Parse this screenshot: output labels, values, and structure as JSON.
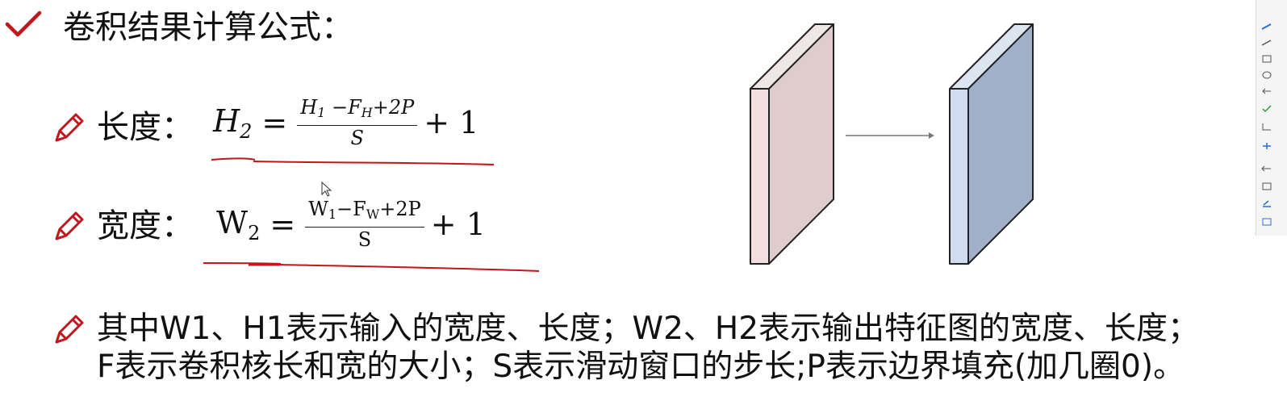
{
  "title": "卷积结果计算公式：",
  "items": [
    {
      "label": "长度：",
      "formula": {
        "lhs": "H",
        "lhs_sub": "2",
        "eq": "=",
        "num_a": "H",
        "num_a_sub": "1",
        "num_b": " −F",
        "num_b_sub": "H",
        "num_c": "+2P",
        "den": "S",
        "tail": "+ 1"
      }
    },
    {
      "label": "宽度：",
      "formula": {
        "lhs": "W",
        "lhs_sub": "2",
        "eq": "=",
        "num_a": "W",
        "num_a_sub": "1",
        "num_b": "−F",
        "num_b_sub": "W",
        "num_c": "+2P",
        "den": "S",
        "tail": "+ 1"
      }
    }
  ],
  "description": {
    "line1": "其中W1、H1表示输入的宽度、长度；W2、H2表示输出特征图的宽度、长度；",
    "line2": "F表示卷积核长和宽的大小；S表示滑动窗口的步长;P表示边界填充(加几圈0)。"
  },
  "colors": {
    "accent_red": "#c0161c",
    "input_front": "#f2dede",
    "input_side": "#dfcccc",
    "output_front": "#cfdcf2",
    "output_side": "#9fb0c8"
  },
  "icons": {
    "check": "check-icon",
    "bullet": "pencil-icon",
    "cursor": "cursor-icon"
  }
}
